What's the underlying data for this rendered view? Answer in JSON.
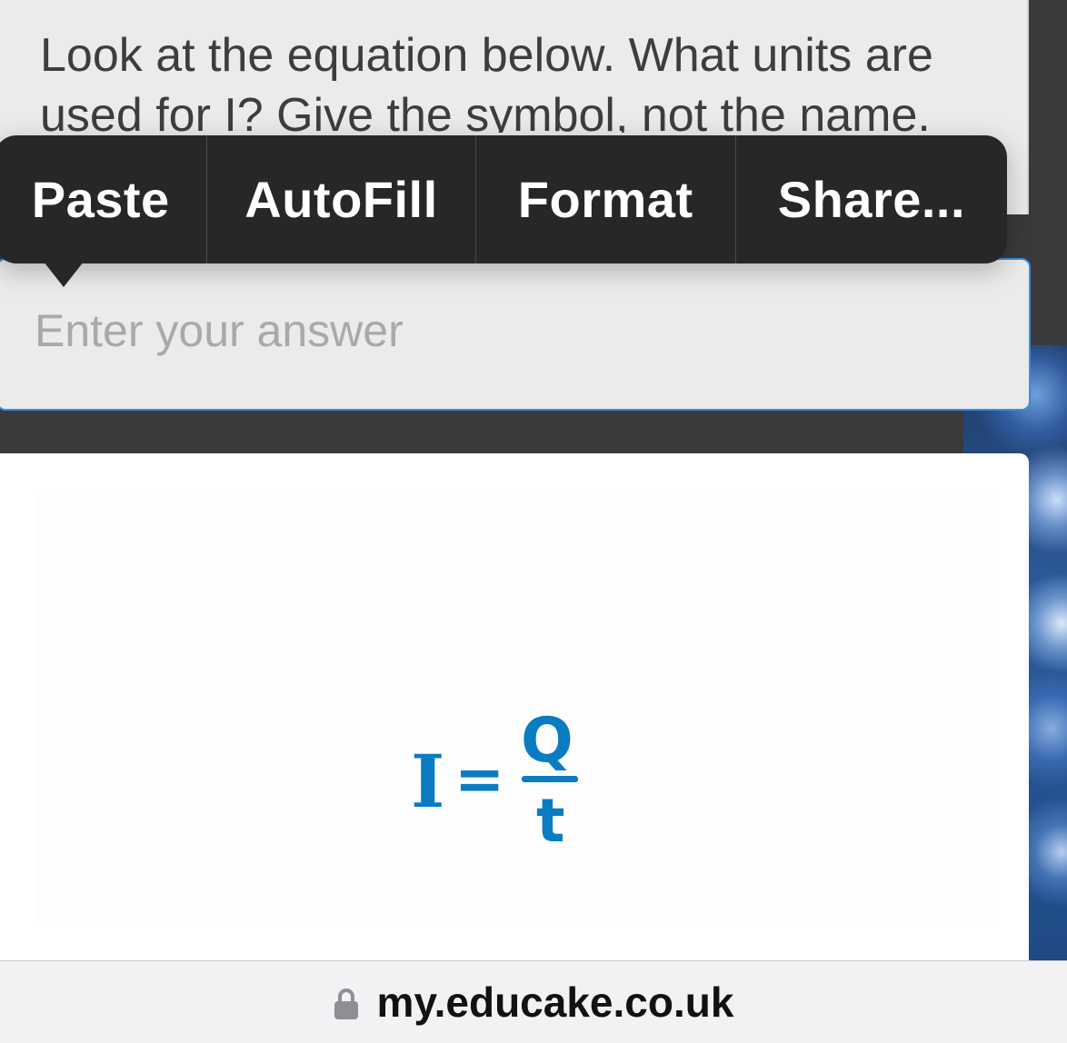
{
  "question": {
    "text": "Look at the equation below. What units are used for I? Give the symbol, not the name."
  },
  "answer": {
    "placeholder": "Enter your answer",
    "value": ""
  },
  "context_menu": {
    "items": [
      "Paste",
      "AutoFill",
      "Format",
      "Share..."
    ]
  },
  "equation": {
    "lhs": "I",
    "equals": "=",
    "numerator": "Q",
    "denominator": "t",
    "color": "#0a7cc1"
  },
  "address_bar": {
    "url": "my.educake.co.uk",
    "icon": "lock-icon"
  }
}
